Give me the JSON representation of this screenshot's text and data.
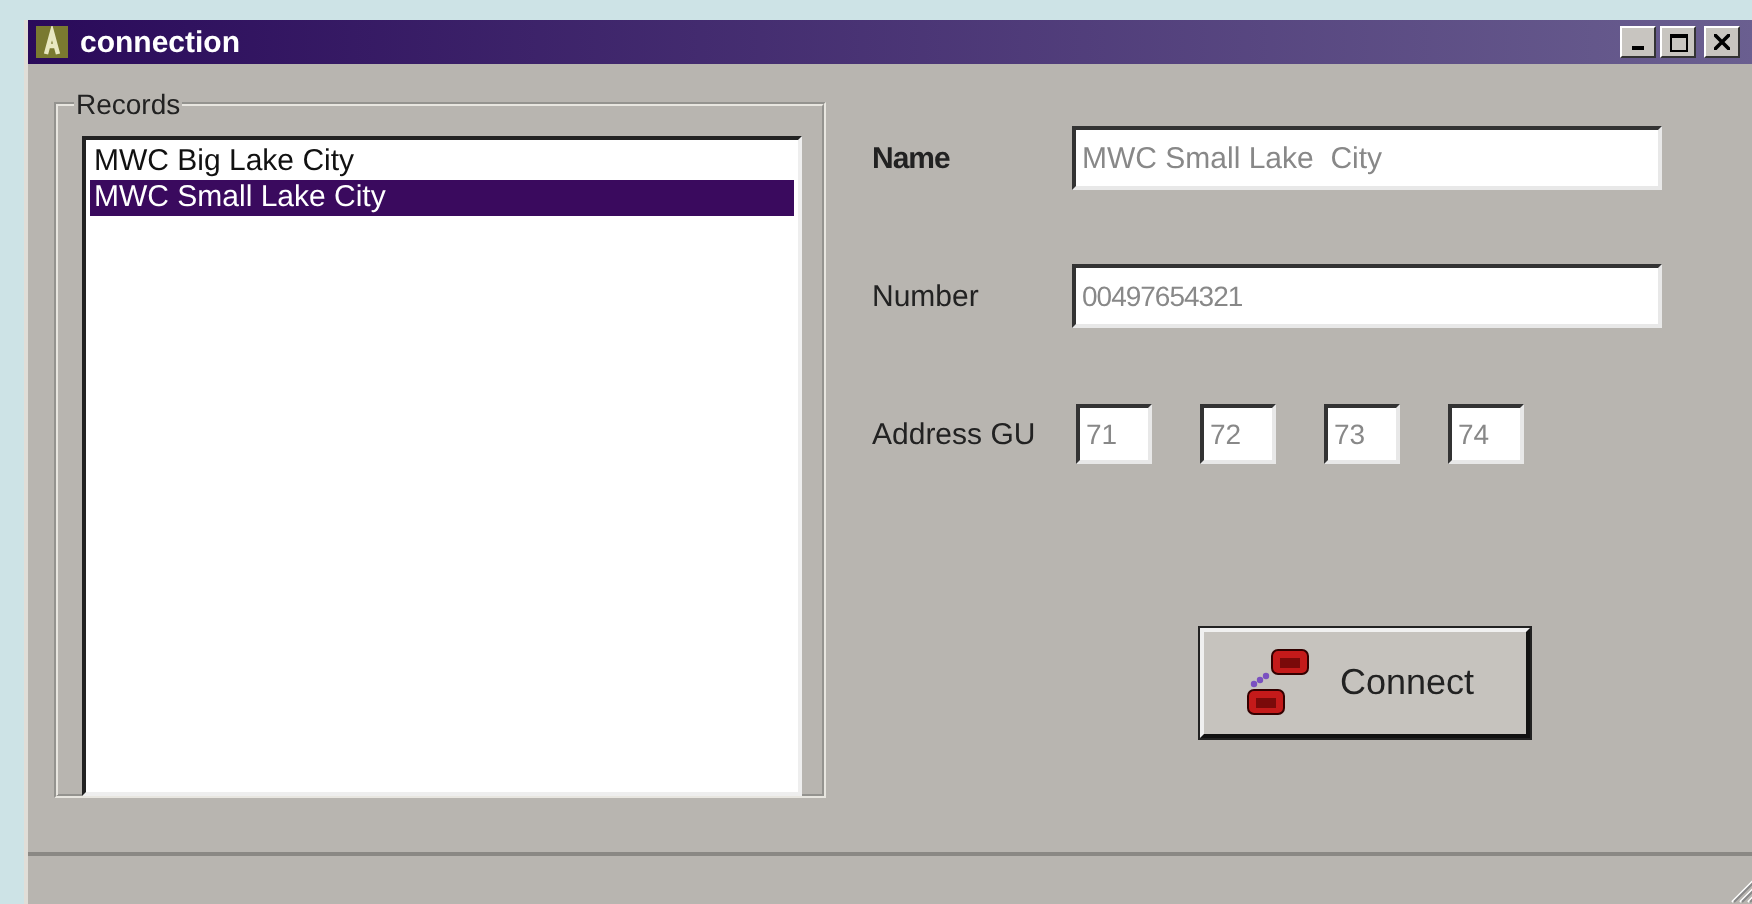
{
  "window": {
    "title": "connection"
  },
  "records": {
    "label": "Records",
    "items": [
      {
        "label": "MWC Big Lake City",
        "selected": false
      },
      {
        "label": "MWC Small Lake City",
        "selected": true
      }
    ]
  },
  "name": {
    "label": "Name",
    "value": "MWC Small Lake  City"
  },
  "number": {
    "label": "Number",
    "value": "00497654321"
  },
  "address": {
    "label": "Address GU",
    "values": [
      "71",
      "72",
      "73",
      "74"
    ]
  },
  "connect_button": {
    "label": "Connect"
  }
}
